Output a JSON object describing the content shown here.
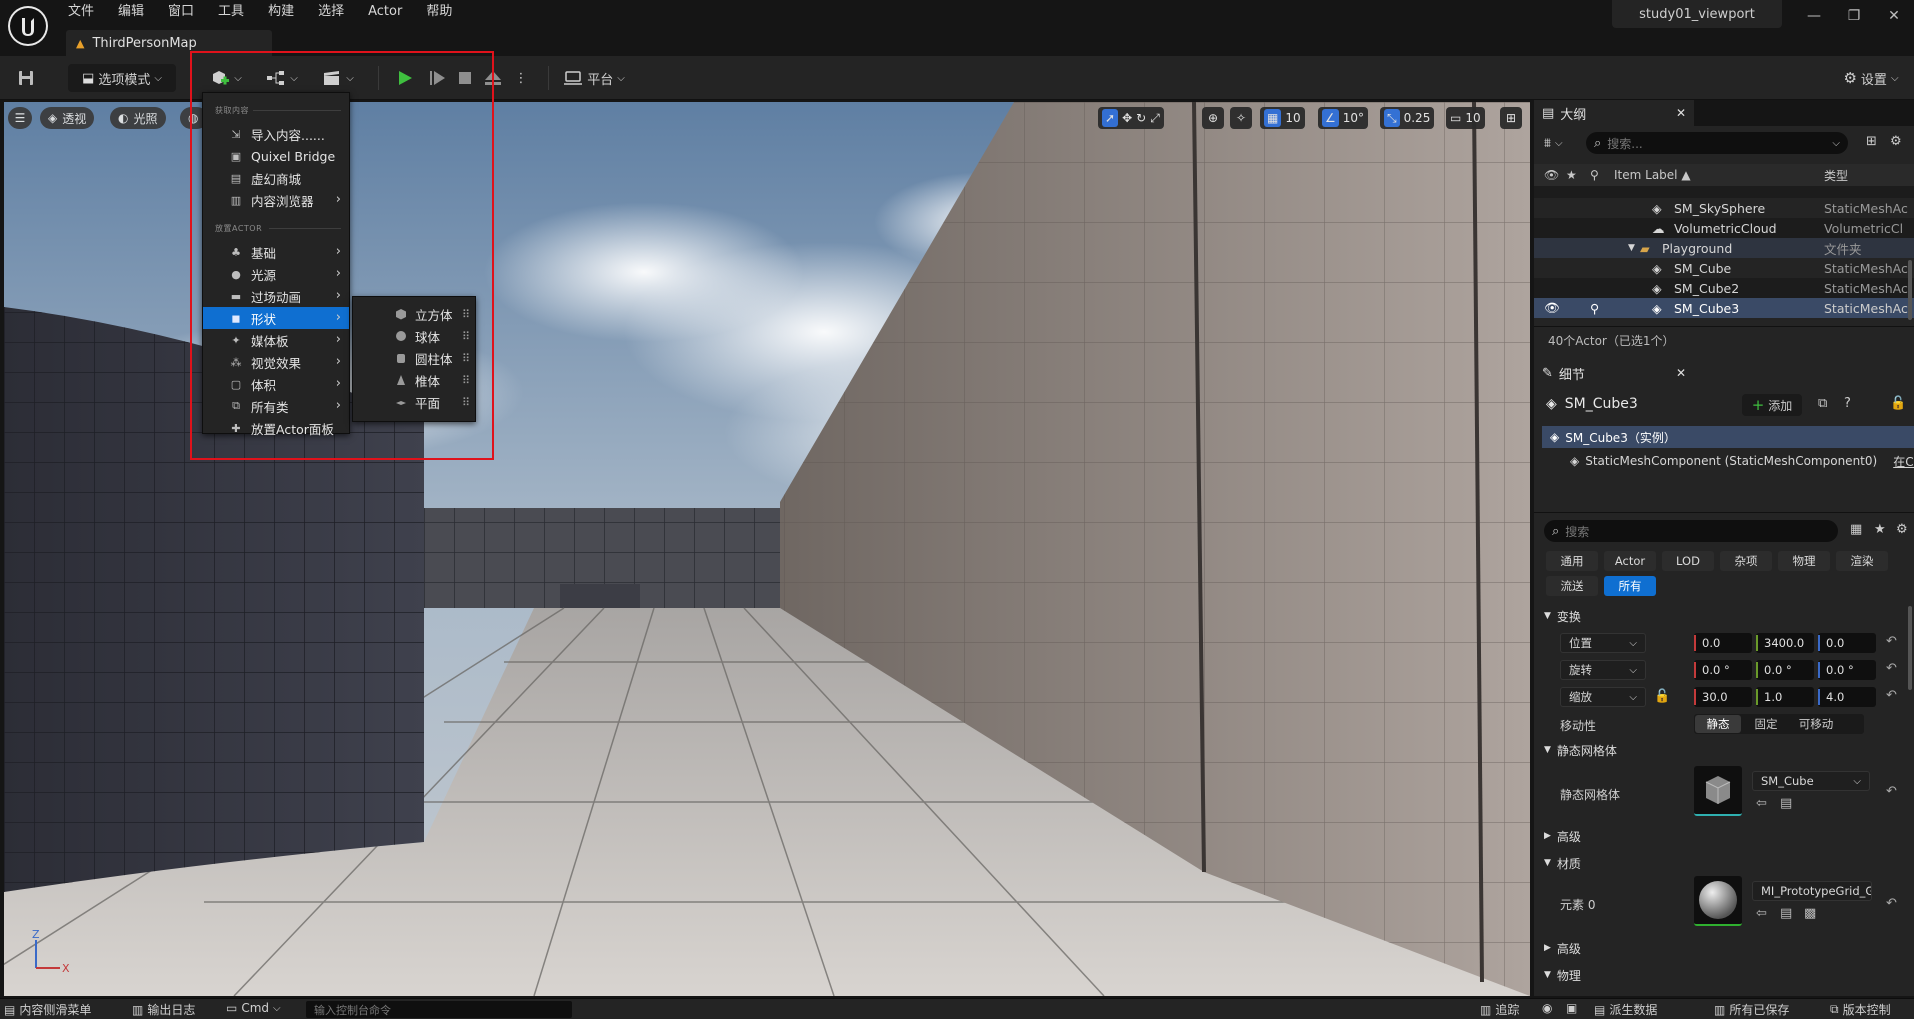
{
  "menubar": {
    "items": [
      "文件",
      "编辑",
      "窗口",
      "工具",
      "构建",
      "选择",
      "Actor",
      "帮助"
    ]
  },
  "window": {
    "project": "study01_viewport",
    "map_tab": "ThirdPersonMap"
  },
  "toolbar": {
    "mode_label": "选项模式",
    "platform_label": "平台",
    "settings_label": "设置"
  },
  "viewport": {
    "perspective_label": "透视",
    "lit_label": "光照",
    "grid_snap": "10",
    "rotate_snap": "10°",
    "scale_snap": "0.25",
    "camera_speed": "10"
  },
  "create_menu": {
    "section_content": "获取内容",
    "section_actor": "放置ACTOR",
    "content_items": [
      "导入内容......",
      "Quixel Bridge",
      "虚幻商城",
      "内容浏览器"
    ],
    "actor_items": [
      "基础",
      "光源",
      "过场动画",
      "形状",
      "媒体板",
      "视觉效果",
      "体积",
      "所有类"
    ],
    "place_panel": "放置Actor面板",
    "selected": "形状"
  },
  "shapes_submenu": {
    "items": [
      "立方体",
      "球体",
      "圆柱体",
      "椎体",
      "平面"
    ]
  },
  "outliner": {
    "title": "大纲",
    "search_placeholder": "搜索...",
    "col_label": "Item Label ▲",
    "col_type": "类型",
    "rows": [
      {
        "label": "SM_SkySphere",
        "type": "StaticMeshAc"
      },
      {
        "label": "VolumetricCloud",
        "type": "VolumetricCl"
      },
      {
        "label": "Playground",
        "type": "文件夹"
      },
      {
        "label": "SM_Cube",
        "type": "StaticMeshAc"
      },
      {
        "label": "SM_Cube2",
        "type": "StaticMeshAc"
      },
      {
        "label": "SM_Cube3",
        "type": "StaticMeshAc"
      }
    ],
    "count": "40个Actor（已选1个）"
  },
  "details": {
    "title": "细节",
    "actor_name": "SM_Cube3",
    "add_label": "添加",
    "instance_label": "SM_Cube3（实例）",
    "component_label": "StaticMeshComponent (StaticMeshComponent0)",
    "component_link": "在C+",
    "search_placeholder": "搜索",
    "categories_row1": [
      "通用",
      "Actor",
      "LOD",
      "杂项",
      "物理",
      "渲染"
    ],
    "categories_row2": [
      "流送",
      "所有"
    ],
    "transform_header": "变换",
    "location_label": "位置",
    "location": [
      "0.0",
      "3400.0",
      "0.0"
    ],
    "rotation_label": "旋转",
    "rotation": [
      "0.0 °",
      "0.0 °",
      "0.0 °"
    ],
    "scale_label": "缩放",
    "scale": [
      "30.0",
      "1.0",
      "4.0"
    ],
    "mobility_label": "移动性",
    "mobility_options": [
      "静态",
      "固定",
      "可移动"
    ],
    "static_mesh_header": "静态网格体",
    "static_mesh_label": "静态网格体",
    "static_mesh_value": "SM_Cube",
    "advanced_label": "高级",
    "materials_header": "材质",
    "element_label": "元素 0",
    "material_value": "MI_PrototypeGrid_Gray",
    "advanced2_label": "高级",
    "physics_header": "物理"
  },
  "statusbar": {
    "content_drawer": "内容侧滑菜单",
    "output_log": "输出日志",
    "cmd_label": "Cmd",
    "console_placeholder": "输入控制台命令",
    "trace_label": "追踪",
    "derived_data": "派生数据",
    "all_saved": "所有已保存",
    "source_control": "版本控制"
  },
  "colors": {
    "accent": "#0f6fd1",
    "highlight_box": "#e0121b",
    "play_green": "#3fbf3f"
  }
}
